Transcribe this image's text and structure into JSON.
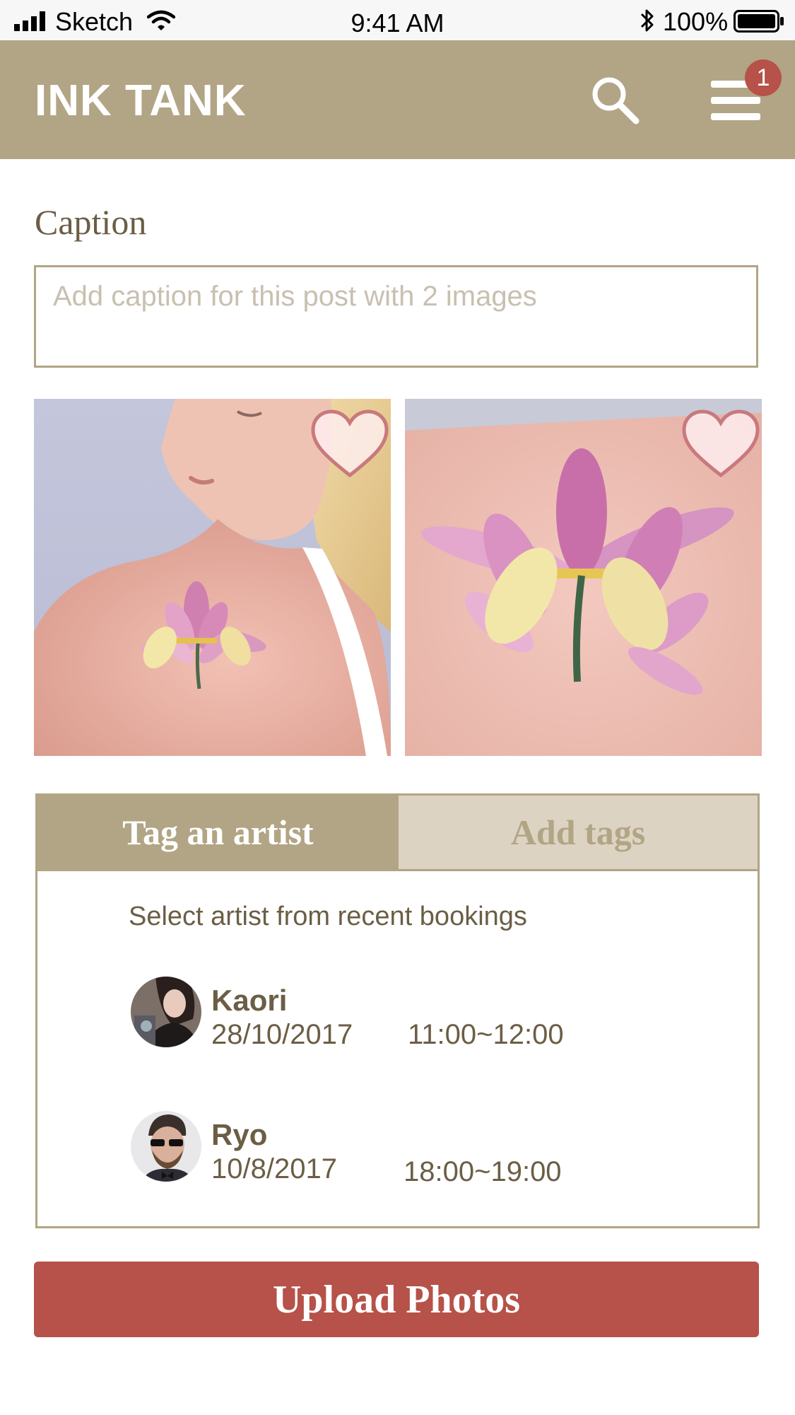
{
  "status_bar": {
    "carrier": "Sketch",
    "time": "9:41 AM",
    "battery_percent": "100%",
    "icons": [
      "signal-icon",
      "wifi-icon",
      "bluetooth-icon",
      "battery-icon"
    ]
  },
  "header": {
    "title": "INK TANK",
    "menu_badge_count": "1",
    "icons": [
      "search-icon",
      "menu-icon"
    ]
  },
  "caption": {
    "label": "Caption",
    "placeholder": "Add caption for this post with 2 images",
    "value": ""
  },
  "photos": [
    {
      "subject": "lotus-tattoo-on-shoulder",
      "favorite": false
    },
    {
      "subject": "lotus-tattoo-closeup",
      "favorite": false
    }
  ],
  "tabs": [
    {
      "label": "Tag an artist",
      "active": true
    },
    {
      "label": "Add tags",
      "active": false
    }
  ],
  "artist_panel": {
    "hint": "Select artist from recent bookings",
    "artists": [
      {
        "name": "Kaori",
        "date": "28/10/2017",
        "time": "11:00~12:00"
      },
      {
        "name": "Ryo",
        "date": "10/8/2017",
        "time": "18:00~19:00"
      }
    ]
  },
  "upload_button": {
    "label": "Upload Photos"
  },
  "colors": {
    "accent": "#b2a585",
    "accent_light": "#ddd3c2",
    "text_brown": "#6b5e45",
    "primary_action": "#b65249"
  }
}
